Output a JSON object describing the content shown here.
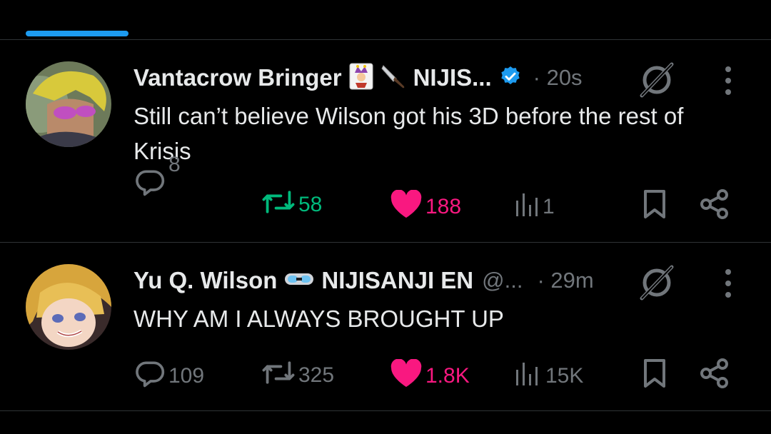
{
  "tweets": [
    {
      "author_name": "Vantacrow Bringer",
      "author_suffix": "NIJIS...",
      "handle": "",
      "time": "· 20s",
      "verified": true,
      "text": "Still can’t believe Wilson got his 3D before the rest of Krisis",
      "replies": "8",
      "retweets": "58",
      "likes": "188",
      "views": "1",
      "retweeted": true,
      "liked": true
    },
    {
      "author_name": "Yu Q. Wilson",
      "author_suffix": "NIJISANJI EN",
      "handle": "@...",
      "time": "· 29m",
      "verified": false,
      "text": "WHY AM I ALWAYS BROUGHT UP",
      "replies": "109",
      "retweets": "325",
      "likes": "1.8K",
      "views": "15K",
      "retweeted": false,
      "liked": true
    }
  ],
  "colors": {
    "accent": "#1d9bf0",
    "retweet_active": "#00ba7c",
    "like_active": "#f91880",
    "muted": "#71767b",
    "text": "#e7e9ea",
    "divider": "#2f3336"
  },
  "icons": [
    "reply-icon",
    "retweet-icon",
    "heart-icon",
    "views-icon",
    "bookmark-icon",
    "share-icon",
    "grok-icon",
    "more-icon",
    "verified-badge-icon"
  ]
}
